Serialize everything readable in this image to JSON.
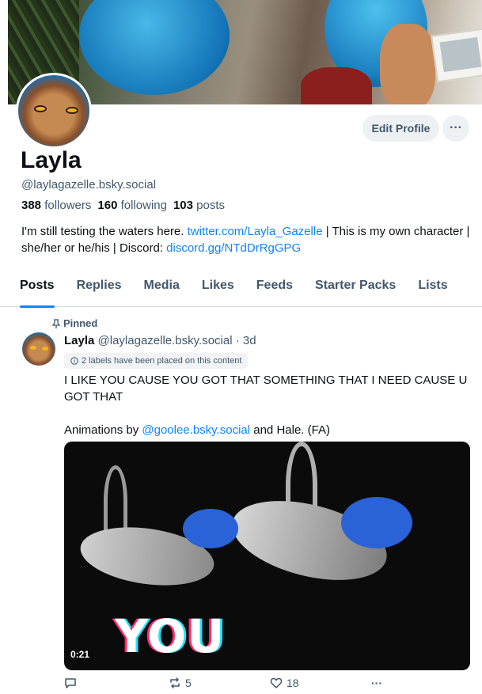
{
  "profile": {
    "display_name": "Layla",
    "handle": "@laylagazelle.bsky.social",
    "followers_count": "388",
    "followers_label": "followers",
    "following_count": "160",
    "following_label": "following",
    "posts_count": "103",
    "posts_label": "posts",
    "bio_part1": "I'm still testing the waters here. ",
    "bio_link1": "twitter.com/Layla_Gazelle",
    "bio_part2": " | This is my own character | she/her or he/his | Discord: ",
    "bio_link2": "discord.gg/NTdDrRgGPG"
  },
  "buttons": {
    "edit_profile": "Edit Profile",
    "more": "···"
  },
  "tabs": [
    {
      "label": "Posts",
      "active": true
    },
    {
      "label": "Replies"
    },
    {
      "label": "Media"
    },
    {
      "label": "Likes"
    },
    {
      "label": "Feeds"
    },
    {
      "label": "Starter Packs"
    },
    {
      "label": "Lists"
    }
  ],
  "post": {
    "pinned_label": "Pinned",
    "author_name": "Layla",
    "author_handle": "@laylagazelle.bsky.social",
    "separator": "·",
    "time": "3d",
    "labels_notice": "2 labels have been placed on this content",
    "text_line1": "I LIKE YOU CAUSE YOU GOT THAT SOMETHING THAT I NEED CAUSE U GOT THAT",
    "text_prefix": "Animations by ",
    "text_mention": "@goolee.bsky.social",
    "text_suffix": " and Hale. (FA)",
    "video_overlay_text": "YOU",
    "video_duration": "0:21",
    "reply_count": "",
    "repost_count": "5",
    "like_count": "18"
  },
  "colors": {
    "accent": "#1083fe",
    "muted": "#42576c",
    "text": "#0b0f14"
  }
}
